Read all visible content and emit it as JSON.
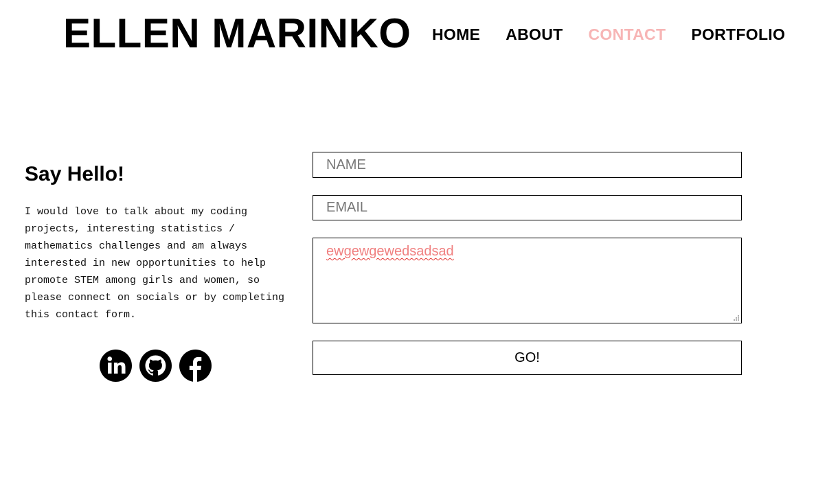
{
  "header": {
    "site_title": "ELLEN MARINKO",
    "nav": [
      {
        "label": "HOME",
        "active": false
      },
      {
        "label": "ABOUT",
        "active": false
      },
      {
        "label": "CONTACT",
        "active": true
      },
      {
        "label": "PORTFOLIO",
        "active": false
      }
    ],
    "active_color": "#f7b5b5"
  },
  "intro": {
    "heading": "Say Hello!",
    "body": "I would love to talk about my coding projects, interesting statistics / mathematics challenges and am always interested in new opportunities to help promote STEM among girls and women, so please connect on socials or by completing this contact form."
  },
  "socials": [
    {
      "icon": "linkedin-icon"
    },
    {
      "icon": "github-icon"
    },
    {
      "icon": "facebook-icon"
    }
  ],
  "form": {
    "name_placeholder": "NAME",
    "name_value": "",
    "email_placeholder": "EMAIL",
    "email_value": "",
    "message_value": "ewgewgewedsadsad",
    "message_color": "#f08080",
    "submit_label": "GO!"
  }
}
